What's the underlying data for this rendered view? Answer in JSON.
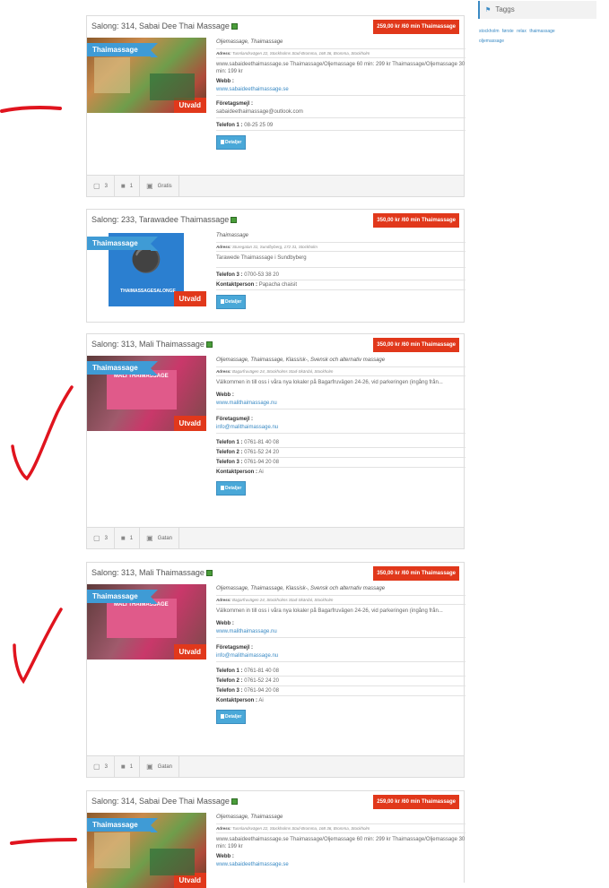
{
  "sidebar": {
    "title": "Taggs",
    "tags": [
      "stockholm",
      "første",
      "relax",
      "thaimassage",
      "oljemassage"
    ]
  },
  "listings": [
    {
      "title": "Salong: 314, Sabai Dee Thai Massage",
      "price": "259,00 kr /60 min Thaimassage",
      "category": "Thaimassage",
      "selected": "Utvald",
      "categories": "Oljemassage, Thaimassage",
      "address_label": "Adress:",
      "address": "Tunnlandsvägen 22, Stockholms Stad-Bromma, 168 36, Bromma, Stockholm",
      "description": "www.sabaideethaimassage.se Thaimassage/Oljemassage 60 min: 299 kr Thaimassage/Oljemassage 30 min: 199 kr",
      "web_label": "Webb :",
      "web": "www.sabaideethaimassage.se",
      "email_label": "Företagsmejl :",
      "email": "sabaideethaimassage@outlook.com",
      "phones": [
        {
          "label": "Telefon 1 :",
          "value": "08-25 25 09"
        }
      ],
      "details_label": "Detaljer",
      "features": {
        "beds": "3",
        "showers": "1",
        "parking": "Gratis"
      }
    },
    {
      "title": "Salong: 233, Tarawadee Thaimassage",
      "price": "350,00 kr /60 min Thaimassage",
      "category": "Thaimassage",
      "selected": "Utvald",
      "brand_text": "THAIMASSAGESALONGE",
      "categories": "Thaimassage",
      "address_label": "Adress:",
      "address": "Sturegatan 31, Sundbyberg, 172 31, Stockholm",
      "description": "Tarawede Thaimassage i Sundbyberg",
      "phones": [
        {
          "label": "Telefon 3 :",
          "value": "0700-53 38 20"
        }
      ],
      "contact_label": "Kontaktperson :",
      "contact": "Papacha chaisit",
      "details_label": "Detaljer"
    },
    {
      "title": "Salong: 313, Mali Thaimassage",
      "price": "350,00 kr /60 min Thaimassage",
      "category": "Thaimassage",
      "selected": "Utvald",
      "banner_title": "MALI THAIMASSAGE",
      "categories": "Oljemassage, Thaimassage, Klassisk-, Svensk och alternativ massage",
      "address_label": "Adress:",
      "address": "Bagarfruvägen 24, Stockholms Stad-Skärdal, Stockholm",
      "description": "Välkommen in till oss i våra nya lokaler på Bagarfruvägen 24-26, vid parkeringen (ingång från...",
      "web_label": "Webb :",
      "web": "www.malithaimassage.nu",
      "email_label": "Företagsmejl :",
      "email": "info@malithaimassage.nu",
      "phones": [
        {
          "label": "Telefon 1 :",
          "value": "0761-81 40 08"
        },
        {
          "label": "Telefon 2 :",
          "value": "0761-52 24 20"
        },
        {
          "label": "Telefon 3 :",
          "value": "0761-94 20 08"
        }
      ],
      "contact_label": "Kontaktperson :",
      "contact": "Ai",
      "details_label": "Detaljer",
      "features": {
        "beds": "3",
        "showers": "1",
        "parking": "Gatan"
      }
    },
    {
      "title": "Salong: 313, Mali Thaimassage",
      "price": "350,00 kr /60 min Thaimassage",
      "category": "Thaimassage",
      "selected": "Utvald",
      "banner_title": "MALI THAIMASSAGE",
      "categories": "Oljemassage, Thaimassage, Klassisk-, Svensk och alternativ massage",
      "address_label": "Adress:",
      "address": "Bagarfruvägen 24, Stockholms Stad-Skärdal, Stockholm",
      "description": "Välkommen in till oss i våra nya lokaler på Bagarfruvägen 24-26, vid parkeringen (ingång från...",
      "web_label": "Webb :",
      "web": "www.malithaimassage.nu",
      "email_label": "Företagsmejl :",
      "email": "info@malithaimassage.nu",
      "phones": [
        {
          "label": "Telefon 1 :",
          "value": "0761-81 40 08"
        },
        {
          "label": "Telefon 2 :",
          "value": "0761-52 24 20"
        },
        {
          "label": "Telefon 3 :",
          "value": "0761-94 20 08"
        }
      ],
      "contact_label": "Kontaktperson :",
      "contact": "Ai",
      "details_label": "Detaljer",
      "features": {
        "beds": "3",
        "showers": "1",
        "parking": "Gatan"
      }
    },
    {
      "title": "Salong: 314, Sabai Dee Thai Massage",
      "price": "259,00 kr /60 min Thaimassage",
      "category": "Thaimassage",
      "selected": "Utvald",
      "categories": "Oljemassage, Thaimassage",
      "address_label": "Adress:",
      "address": "Tunnlandsvägen 22, Stockholms Stad-Bromma, 168 36, Bromma, Stockholm",
      "description": "www.sabaideethaimassage.se Thaimassage/Oljemassage 60 min: 299 kr Thaimassage/Oljemassage 30 min: 199 kr",
      "web_label": "Webb :",
      "web": "www.sabaideethaimassage.se"
    }
  ],
  "colors": {
    "accent": "#3a8ac4",
    "ribbon": "#3f9bd5",
    "badge": "#e1381b",
    "annotation": "#e0141e"
  },
  "icons": {
    "beds": "bed-icon",
    "showers": "bathtub-icon",
    "parking": "car-icon",
    "details": "document-icon",
    "verified": "verified-icon",
    "tag": "tag-icon"
  }
}
